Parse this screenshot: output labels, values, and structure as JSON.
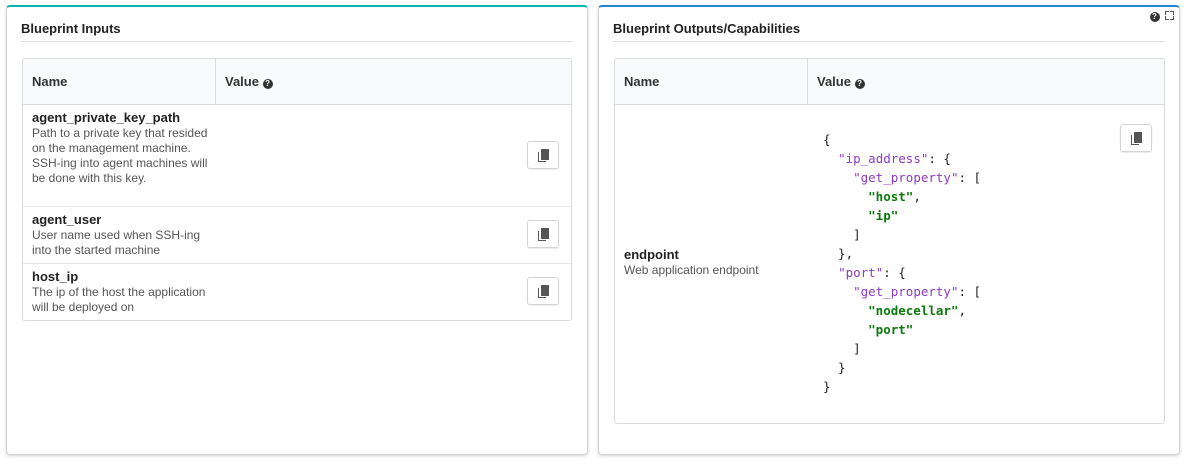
{
  "inputs_widget": {
    "title": "Blueprint Inputs",
    "columns": {
      "name": "Name",
      "value": "Value"
    },
    "rows": [
      {
        "name": "agent_private_key_path",
        "description": "Path to a private key that resided on the management machine. SSH-ing into agent machines will be done with this key."
      },
      {
        "name": "agent_user",
        "description": "User name used when SSH-ing into the started machine"
      },
      {
        "name": "host_ip",
        "description": "The ip of the host the application will be deployed on"
      }
    ]
  },
  "outputs_widget": {
    "title": "Blueprint Outputs/Capabilities",
    "columns": {
      "name": "Name",
      "value": "Value"
    },
    "rows": [
      {
        "name": "endpoint",
        "description": "Web application endpoint",
        "value": {
          "ip_address": {
            "get_property": [
              "host",
              "ip"
            ]
          },
          "port": {
            "get_property": [
              "nodecellar",
              "port"
            ]
          }
        }
      }
    ]
  },
  "icons": {
    "help": "question-circle-icon",
    "expand": "expand-icon",
    "copy": "copy-icon"
  }
}
